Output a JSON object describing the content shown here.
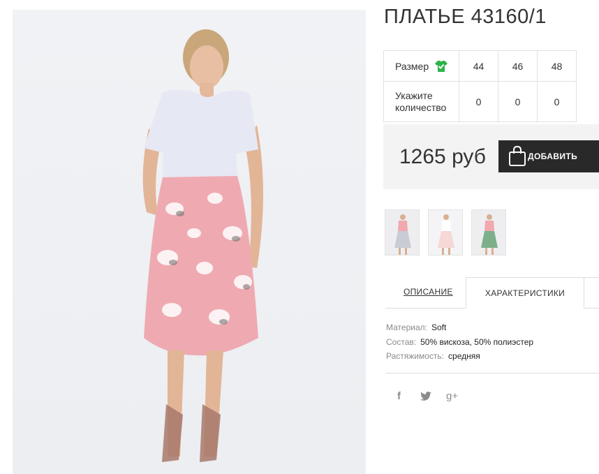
{
  "product": {
    "title": "ПЛАТЬЕ 43160/1"
  },
  "size_table": {
    "size_label": "Размер",
    "sizes": [
      "44",
      "46",
      "48"
    ],
    "quantity_label": "Укажите количество",
    "quantities": [
      "0",
      "0",
      "0"
    ],
    "check_icon_color": "#2db34a"
  },
  "purchase": {
    "price": "1265 руб",
    "add_button_label": "ДОБАВИТЬ"
  },
  "thumbnails": [
    {
      "name": "thumbnail-1",
      "icon": "dress-photo"
    },
    {
      "name": "thumbnail-2",
      "icon": "dress-photo"
    },
    {
      "name": "thumbnail-3",
      "icon": "dress-photo"
    }
  ],
  "tabs": {
    "description": "ОПИСАНИЕ",
    "characteristics": "ХАРАКТЕРИСТИКИ"
  },
  "specs": {
    "material_label": "Материал:",
    "material_value": "Soft",
    "composition_label": "Состав:",
    "composition_value": "50% вискоза, 50% полиэстер",
    "stretch_label": "Растяжимость:",
    "stretch_value": "средняя"
  },
  "social": {
    "facebook": "f",
    "twitter": "twitter-icon",
    "googleplus": "g+"
  }
}
